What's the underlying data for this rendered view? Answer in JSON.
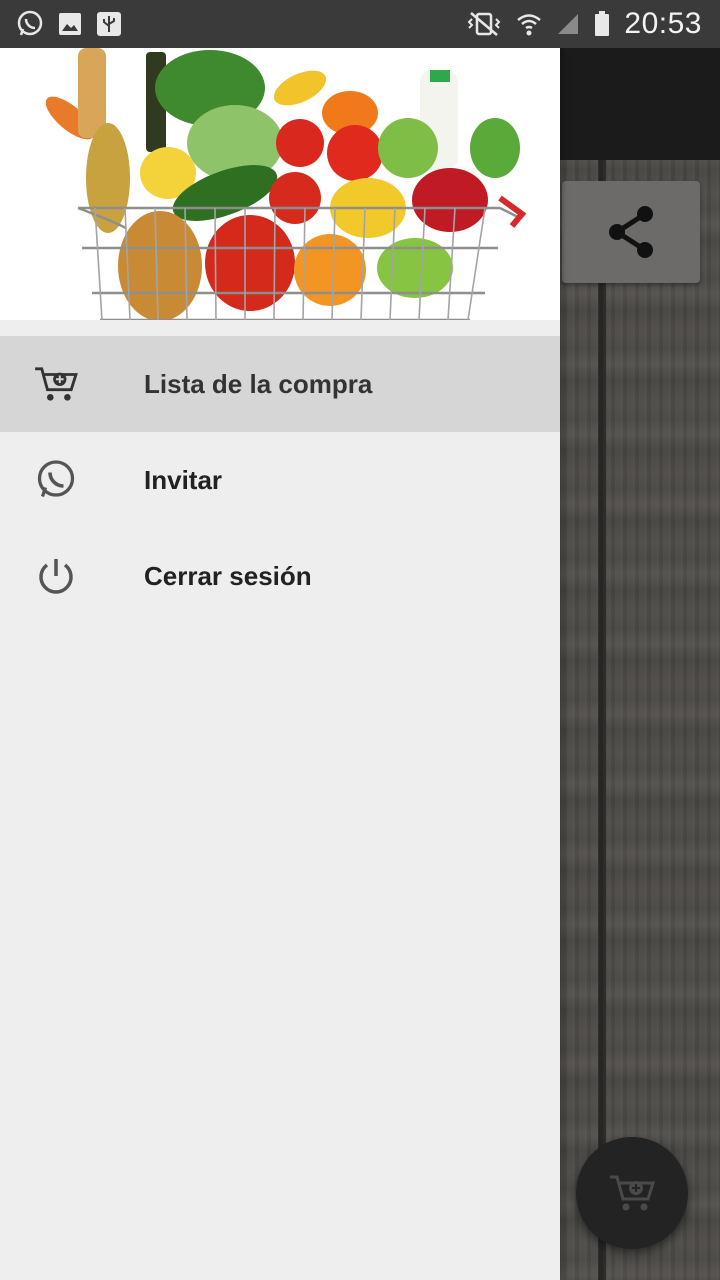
{
  "status_bar": {
    "time": "20:53",
    "left_icons": [
      "whatsapp-icon",
      "image-icon",
      "usb-icon"
    ],
    "right_icons": [
      "vibrate-icon",
      "wifi-icon",
      "signal-icon",
      "battery-icon"
    ]
  },
  "drawer": {
    "header_image": "grocery-basket-image",
    "items": [
      {
        "label": "Lista de la compra",
        "icon": "add-to-cart-icon",
        "active": true
      },
      {
        "label": "Invitar",
        "icon": "whatsapp-icon",
        "active": false
      },
      {
        "label": "Cerrar sesión",
        "icon": "power-icon",
        "active": false
      }
    ]
  },
  "background_app": {
    "share_icon": "share-icon",
    "fab_icon": "add-to-cart-icon"
  },
  "colors": {
    "status_bar": "#3a3a3a",
    "drawer_bg": "#eeeeee",
    "active_item": "#d6d6d6",
    "toolbar": "#1b1b1b",
    "fab": "#232323"
  }
}
